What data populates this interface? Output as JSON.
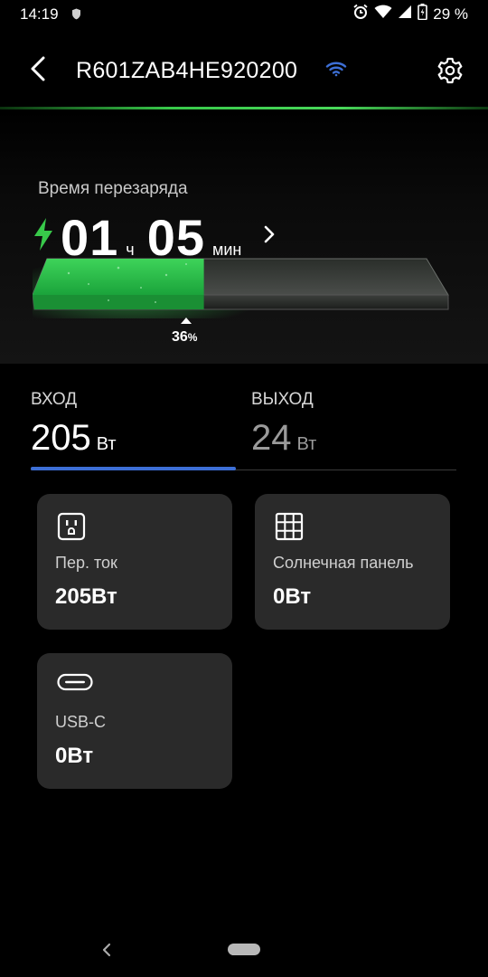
{
  "status_bar": {
    "time": "14:19",
    "battery_text": "29 %",
    "icons": [
      "shield-icon",
      "alarm-icon",
      "wifi-icon",
      "signal-icon",
      "battery-icon"
    ]
  },
  "header": {
    "title": "R601ZAB4HE920200",
    "back_icon": "arrow-left-icon",
    "settings_icon": "gear-icon",
    "connection_icon": "wifi-icon"
  },
  "recharge": {
    "label": "Время перезаряда",
    "hours": "01",
    "hours_unit": "ч",
    "minutes": "05",
    "minutes_unit": "мин",
    "percent": "36",
    "percent_sign": "%",
    "level": 0.36
  },
  "io": {
    "input_label": "ВХОД",
    "input_value": "205",
    "input_unit": "Вт",
    "output_label": "ВЫХОД",
    "output_value": "24",
    "output_unit": "Вт",
    "active_tab": "input"
  },
  "cards": [
    {
      "label": "Пер. ток",
      "value": "205Вт",
      "icon": "ac-outlet-icon"
    },
    {
      "label": "Солнечная панель",
      "value": "0Вт",
      "icon": "solar-panel-icon"
    },
    {
      "label": "USB-C",
      "value": "0Вт",
      "icon": "usb-c-icon"
    }
  ],
  "colors": {
    "accent_green": "#38c94a",
    "tab_blue": "#3d6fd6",
    "card_bg": "#2a2a2a"
  }
}
